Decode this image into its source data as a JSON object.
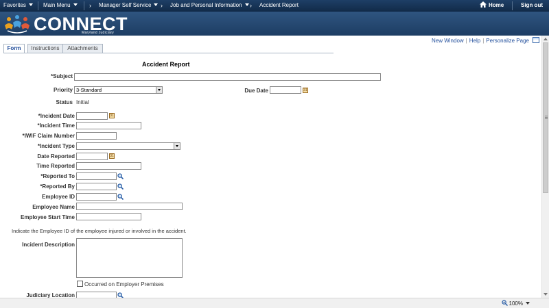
{
  "nav": {
    "favorites": "Favorites",
    "main_menu": "Main Menu",
    "manager_self_service": "Manager Self Service",
    "job_personal_info": "Job and Personal Information",
    "accident_report": "Accident Report",
    "home": "Home",
    "sign_out": "Sign out"
  },
  "banner": {
    "brand": "CONNECT",
    "sub": "Maryland Judiciary"
  },
  "page_links": {
    "new_window": "New Window",
    "help": "Help",
    "personalize": "Personalize Page"
  },
  "tabs": [
    {
      "label": "Form"
    },
    {
      "label": "Instructions"
    },
    {
      "label": "Attachments"
    }
  ],
  "form": {
    "title": "Accident Report",
    "subject_label": "*Subject",
    "priority_label": "Priority",
    "priority_value": "3-Standard",
    "due_date_label": "Due Date",
    "status_label": "Status",
    "status_value": "Initial",
    "incident_date_label": "*Incident Date",
    "incident_time_label": "*Incident Time",
    "iwif_label": "*IWIF Claim Number",
    "incident_type_label": "*Incident Type",
    "date_reported_label": "Date Reported",
    "time_reported_label": "Time Reported",
    "reported_to_label": "*Reported To",
    "reported_by_label": "*Reported By",
    "employee_id_label": "Employee ID",
    "employee_name_label": "Employee Name",
    "employee_start_label": "Employee Start Time",
    "hint": "Indicate the Employee ID of the employee injured or involved in the accident.",
    "incident_desc_label": "Incident Description",
    "premises_label": "Occurred on Employer Premises",
    "location_label": "Judiciary Location"
  },
  "status_bar": {
    "zoom": "100%"
  },
  "colors": {
    "nav_bg": "#112a48",
    "banner_bg": "#2f5580",
    "link": "#1f4c9a"
  }
}
